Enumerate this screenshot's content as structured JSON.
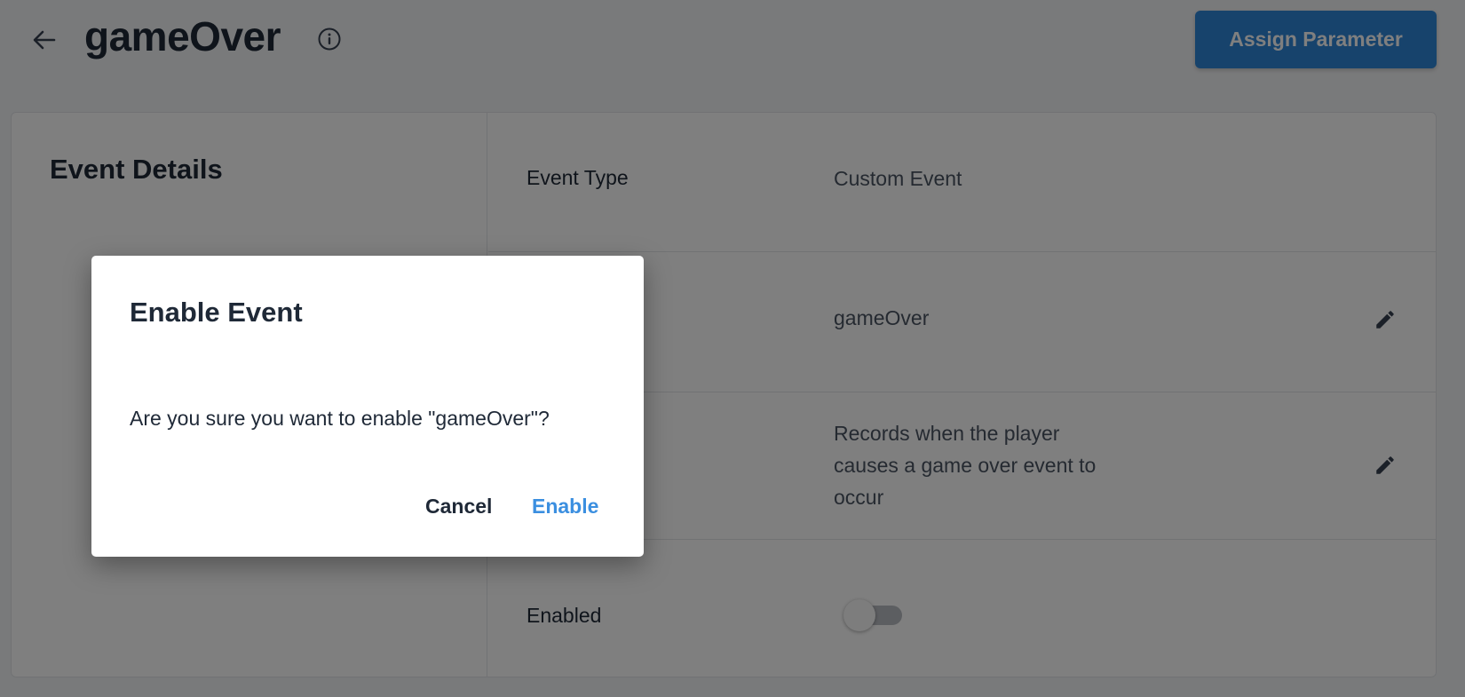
{
  "header": {
    "title": "gameOver",
    "back_icon": "arrow-left-icon",
    "info_icon": "info-circle-icon",
    "assign_button_label": "Assign Parameter"
  },
  "details": {
    "section_title": "Event Details",
    "rows": [
      {
        "label": "Event Type",
        "value": "Custom Event"
      },
      {
        "label": "",
        "value": "gameOver",
        "editable": true
      },
      {
        "label": "",
        "value": "Records when the player causes a game over event to occur",
        "editable": true
      },
      {
        "label": "Enabled",
        "toggle_on": false
      }
    ]
  },
  "dialog": {
    "title": "Enable Event",
    "message": "Are you sure you want to enable \"gameOver\"?",
    "cancel_label": "Cancel",
    "confirm_label": "Enable"
  },
  "colors": {
    "primary": "#2f86d8",
    "confirm_text": "#3b8fe0",
    "overlay": "rgba(0,0,0,0.5)"
  }
}
